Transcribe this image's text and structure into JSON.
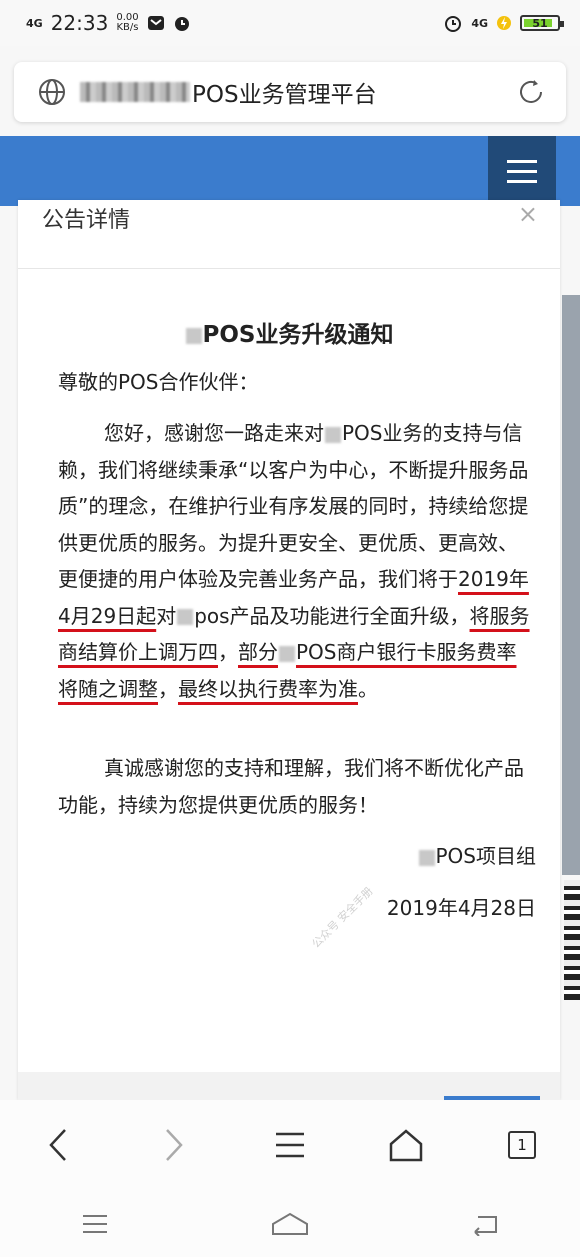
{
  "status_bar": {
    "network": "4G",
    "time": "22:33",
    "speed_value": "0.00",
    "speed_unit": "KB/s",
    "right_network": "4G",
    "battery": "51"
  },
  "browser": {
    "page_title": "POS业务管理平台"
  },
  "panel": {
    "header_title": "公告详情",
    "close_glyph": "×"
  },
  "notice": {
    "title": "POS业务升级通知",
    "greeting": "尊敬的POS合作伙伴：",
    "p1_a": "您好，感谢您一路走来对",
    "p1_b": "POS业务的支持与信赖，我们将继续秉承“以客户为中心，不断提升服务品质”的理念，在维护行业有序发展的同时，持续给您提供更优质的服务。为提升更安全、更优质、更高效、更便捷的用户体验及完善业务产品，我们将于",
    "p1_date": "2019年4月29日起",
    "p1_c": "对",
    "p1_d": "pos产品及功能进行全面升级，",
    "p1_u1": "将服务商结算价上调万四",
    "p1_e": "，",
    "p1_u2a": "部分",
    "p1_u2b": "POS商户银行卡服务费率将随之调整",
    "p1_f": "，",
    "p1_u3": "最终以执行费率为准",
    "p1_g": "。",
    "p2": "真诚感谢您的支持和理解，我们将不断优化产品功能，持续为您提供更优质的服务！",
    "signature": "POS项目组",
    "date": "2019年4月28日"
  },
  "watermark": "公众号 安全手册",
  "icons": {
    "globe": "globe-icon",
    "reload": "reload-icon",
    "menu": "hamburger-menu-icon",
    "back": "back-arrow-icon",
    "forward": "forward-arrow-icon",
    "browser_menu": "browser-menu-icon",
    "home": "home-icon",
    "tabs": "tabs-icon"
  },
  "tabs_count": "1",
  "colors": {
    "nav_blue": "#3b7ccd",
    "menu_dark": "#214a78",
    "underline_red": "#d4101a"
  }
}
